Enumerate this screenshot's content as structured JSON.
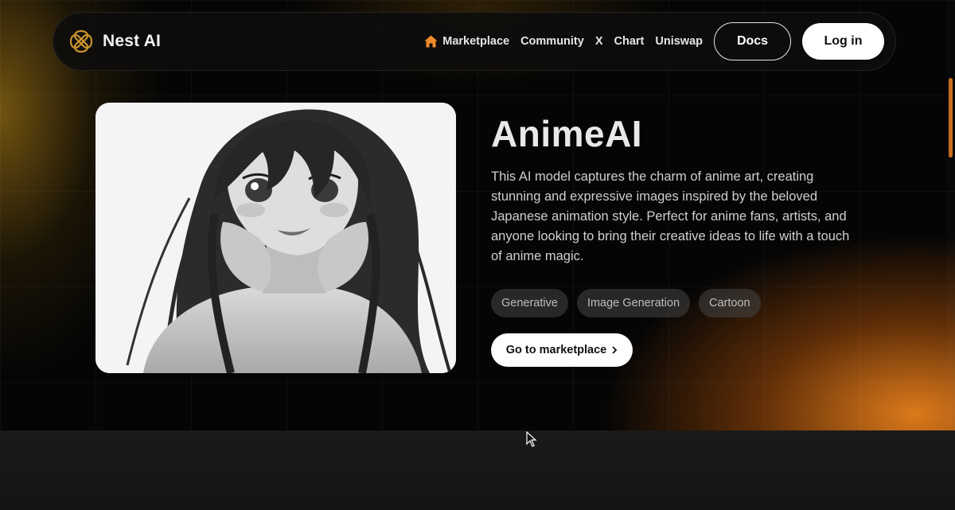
{
  "brand": {
    "name": "Nest AI"
  },
  "nav": {
    "links": [
      {
        "label": "Marketplace",
        "icon": "home-icon"
      },
      {
        "label": "Community"
      },
      {
        "label": "X"
      },
      {
        "label": "Chart"
      },
      {
        "label": "Uniswap"
      }
    ],
    "docs_label": "Docs",
    "login_label": "Log in"
  },
  "product": {
    "title": "AnimeAI",
    "description": "This AI model captures the charm of anime art, creating stunning and expressive images inspired by the beloved Japanese animation style. Perfect for anime fans, artists, and anyone looking to bring their creative ideas to life with a touch of anime magic.",
    "tags": [
      "Generative",
      "Image Generation",
      "Cartoon"
    ],
    "cta_label": "Go to marketplace",
    "cta_icon": "chevron-right-icon",
    "image": "anime-girl-illustration"
  },
  "colors": {
    "accent": "#e8801c",
    "brand_gold": "#c9932e",
    "background": "#050505"
  }
}
